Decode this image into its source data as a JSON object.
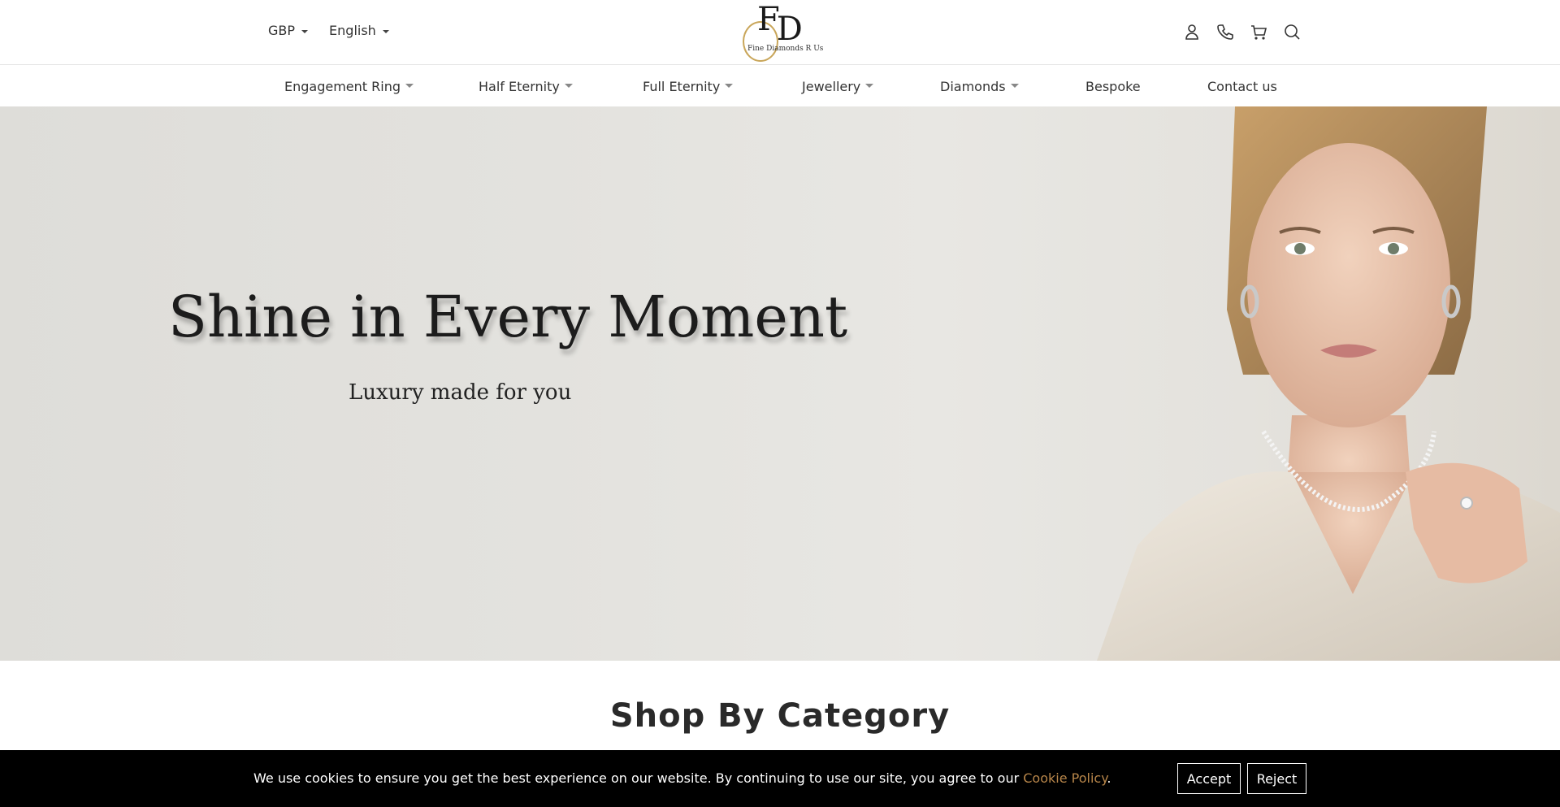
{
  "header": {
    "currency": "GBP",
    "language": "English",
    "logo": {
      "letters": "FD",
      "tagline": "Fine Diamonds R Us"
    },
    "icons": [
      "user-icon",
      "phone-icon",
      "cart-icon",
      "search-icon"
    ]
  },
  "nav": {
    "items": [
      {
        "label": "Engagement Ring",
        "dropdown": true
      },
      {
        "label": "Half Eternity",
        "dropdown": true
      },
      {
        "label": "Full Eternity",
        "dropdown": true
      },
      {
        "label": "Jewellery",
        "dropdown": true
      },
      {
        "label": "Diamonds",
        "dropdown": true
      },
      {
        "label": "Bespoke",
        "dropdown": false
      },
      {
        "label": "Contact us",
        "dropdown": false
      }
    ]
  },
  "hero": {
    "title": "Shine in Every Moment",
    "subtitle": "Luxury made for you"
  },
  "section": {
    "title": "Shop By Category"
  },
  "cookie": {
    "text": "We use cookies to ensure you get the best experience on our website. By continuing to use our site, you agree to our ",
    "link": "Cookie Policy",
    "end": ".",
    "accept": "Accept",
    "reject": "Reject"
  },
  "colors": {
    "accent": "#b8864a",
    "logo_gold": "#c9a65a"
  }
}
